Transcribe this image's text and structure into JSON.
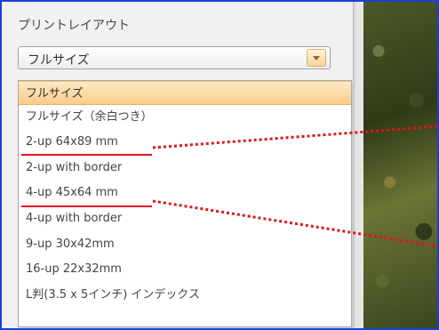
{
  "panel": {
    "title": "プリントレイアウト",
    "select_value": "フルサイズ"
  },
  "dropdown": {
    "options": [
      {
        "label": "フルサイズ",
        "selected": true
      },
      {
        "label": "フルサイズ（余白つき）",
        "selected": false
      },
      {
        "label": "2-up 64x89 mm",
        "selected": false,
        "highlighted": true
      },
      {
        "label": "2-up with border",
        "selected": false
      },
      {
        "label": "4-up 45x64 mm",
        "selected": false,
        "highlighted": true
      },
      {
        "label": "4-up with border",
        "selected": false
      },
      {
        "label": "9-up 30x42mm",
        "selected": false
      },
      {
        "label": "16-up 22x32mm",
        "selected": false
      },
      {
        "label": "L判(3.5 x 5インチ) インデックス",
        "selected": false
      }
    ]
  },
  "colors": {
    "frame": "#1a3fd6",
    "callout": "#e01717",
    "selected_fill": "#f9cd8a"
  }
}
